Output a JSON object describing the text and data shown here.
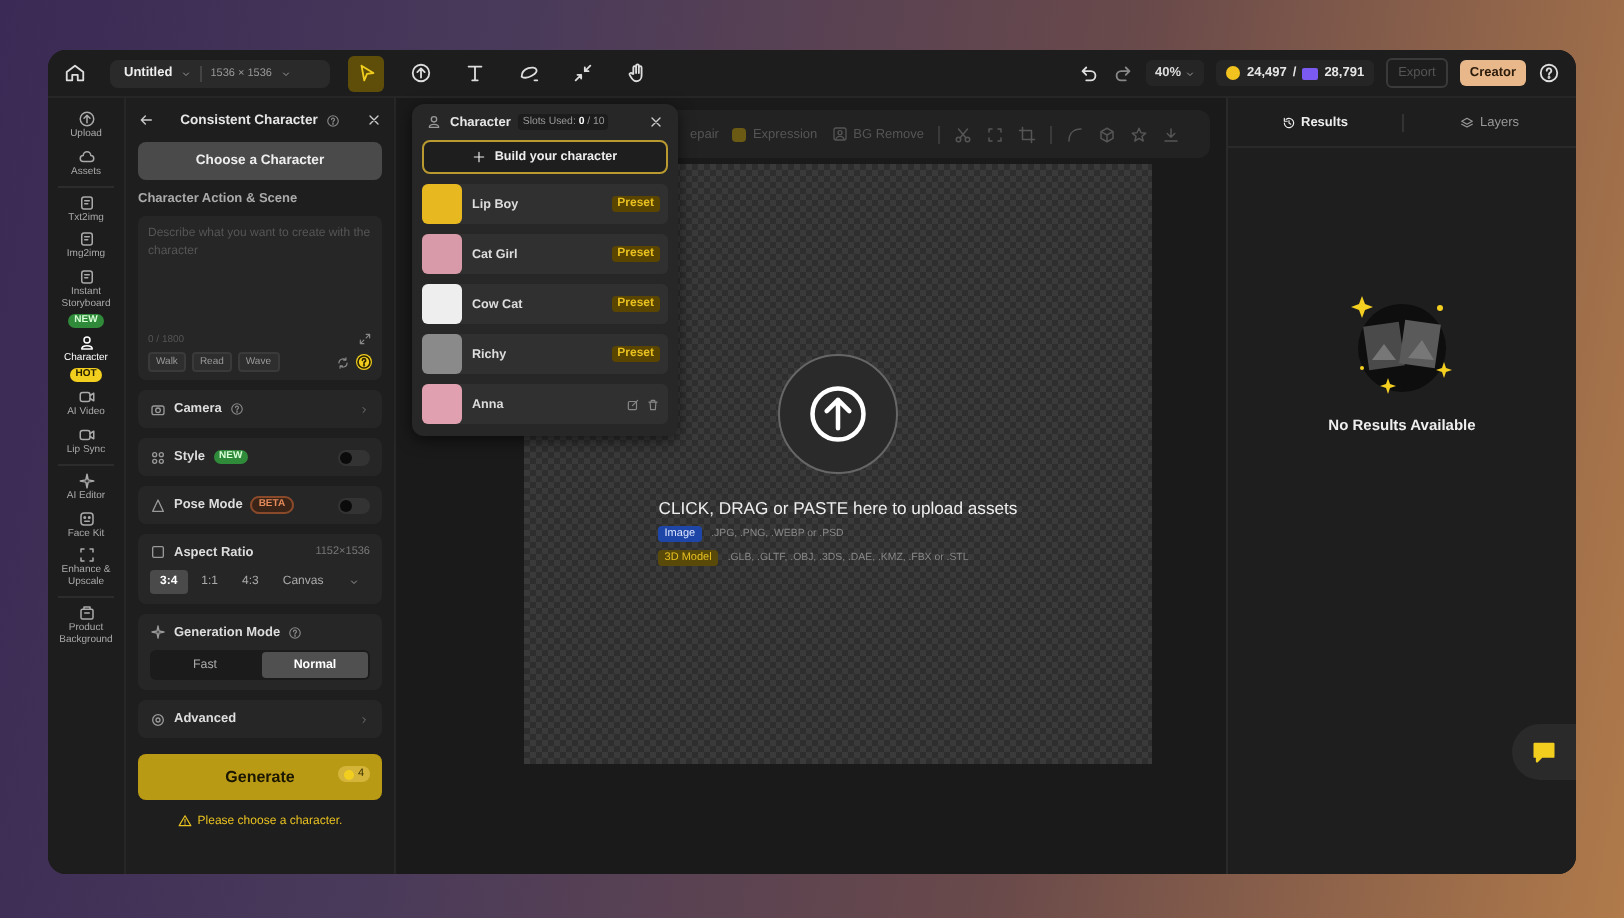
{
  "top_bar": {
    "file_name": "Untitled",
    "canvas_size": "1536 × 1536",
    "tools": [
      {
        "kind": "select",
        "selected": true
      },
      {
        "kind": "upload",
        "selected": false
      },
      {
        "kind": "text",
        "selected": false
      },
      {
        "kind": "shape",
        "selected": false
      },
      {
        "kind": "shrink",
        "selected": false
      },
      {
        "kind": "hand",
        "selected": false
      }
    ],
    "zoom": "40%",
    "credits_gold": "24,497",
    "credits_separator": "/",
    "credits_purple": "28,791",
    "export_button": {
      "label": "Export",
      "disabled": true
    },
    "plan_button": "Creator"
  },
  "nav_rail": [
    {
      "label": "Upload",
      "selected": false
    },
    {
      "label": "Assets",
      "selected": false
    },
    {
      "label": "Txt2img",
      "selected": false
    },
    {
      "label": "Img2img",
      "selected": false
    },
    {
      "label": "Instant Storyboard",
      "selected": false,
      "badge": {
        "text": "NEW",
        "kind": "new"
      }
    },
    {
      "label": "Character",
      "selected": true,
      "badge": {
        "text": "HOT",
        "kind": "hot"
      }
    },
    {
      "label": "AI Video",
      "selected": false
    },
    {
      "label": "Lip Sync",
      "selected": false
    },
    {
      "label": "AI Editor",
      "selected": false
    },
    {
      "label": "Face Kit",
      "selected": false
    },
    {
      "label": "Enhance & Upscale",
      "selected": false
    },
    {
      "label": "Product Background",
      "selected": false
    }
  ],
  "left_panel": {
    "title": "Consistent Character",
    "choose_button": "Choose a Character",
    "prompt_label": "Character Action & Scene",
    "prompt": {
      "placeholder": "Describe what you want to create with the character",
      "counter": "0 / 1800",
      "chips": [
        "Walk",
        "Read",
        "Wave"
      ]
    },
    "sections": [
      {
        "kind": "link",
        "label": "Camera",
        "help": true
      },
      {
        "kind": "toggle",
        "label": "Style",
        "badge": {
          "text": "NEW",
          "kind": "new"
        },
        "on": false
      },
      {
        "kind": "toggle",
        "label": "Pose Mode",
        "badge": {
          "text": "BETA",
          "kind": "beta"
        },
        "on": false
      }
    ],
    "aspect_ratio": {
      "label": "Aspect Ratio",
      "size": "1152×1536",
      "options": [
        {
          "label": "3:4",
          "selected": true
        },
        {
          "label": "1:1",
          "selected": false
        },
        {
          "label": "4:3",
          "selected": false
        }
      ],
      "dropdown": "Canvas"
    },
    "generation_mode": {
      "label": "Generation Mode",
      "options": [
        {
          "label": "Fast",
          "selected": false
        },
        {
          "label": "Normal",
          "selected": true
        }
      ]
    },
    "advanced": "Advanced",
    "generate": {
      "label": "Generate",
      "cost": "4"
    },
    "warning": "Please choose a character."
  },
  "character_popover": {
    "title": "Character",
    "slots": "Slots Used: **0** / 10",
    "build_button": "Build your character",
    "characters": [
      {
        "name": "Lip Boy",
        "kind": "preset",
        "tag": "Preset",
        "color": "#e8b820"
      },
      {
        "name": "Cat Girl",
        "kind": "preset",
        "tag": "Preset",
        "color": "#d89aa8"
      },
      {
        "name": "Cow Cat",
        "kind": "preset",
        "tag": "Preset",
        "color": "#eeeeee"
      },
      {
        "name": "Richy",
        "kind": "preset",
        "tag": "Preset",
        "color": "#8a8a8a"
      },
      {
        "name": "Anna",
        "kind": "custom",
        "color": "#e0a0b0"
      }
    ]
  },
  "canvas_toolbar": [
    {
      "kind": "label",
      "label": "epair"
    },
    {
      "kind": "expression",
      "label": "Expression"
    },
    {
      "kind": "bg_remove",
      "label": "BG Remove"
    },
    {
      "kind": "divider"
    },
    {
      "kind": "scissors"
    },
    {
      "kind": "frame"
    },
    {
      "kind": "crop"
    },
    {
      "kind": "divider"
    },
    {
      "kind": "curve"
    },
    {
      "kind": "cube"
    },
    {
      "kind": "star"
    },
    {
      "kind": "download"
    }
  ],
  "upload_area": {
    "headline": "CLICK, DRAG or PASTE here to upload assets",
    "formats": [
      {
        "tag": "Image",
        "kind": "image",
        "extensions": ".JPG, .PNG, .WEBP or .PSD"
      },
      {
        "tag": "3D Model",
        "kind": "model",
        "extensions": ".GLB, .GLTF, .OBJ, .3DS, .DAE, .KMZ, .FBX or .STL"
      }
    ]
  },
  "right_panel": {
    "tabs": [
      {
        "label": "Results",
        "selected": true
      },
      {
        "label": "Layers",
        "selected": false
      }
    ],
    "empty_message": "No Results Available"
  }
}
